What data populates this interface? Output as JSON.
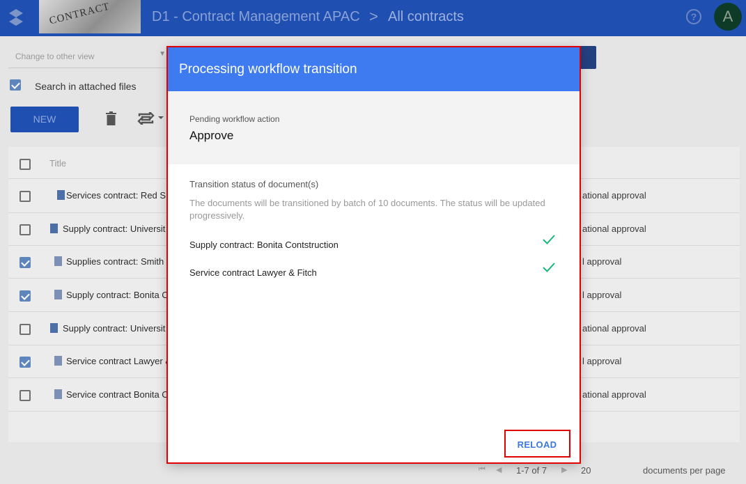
{
  "header": {
    "thumbnail_text": "CONTRACT",
    "breadcrumb_domain": "D1 - Contract Management APAC",
    "breadcrumb_separator": ">",
    "breadcrumb_page": "All contracts",
    "help_glyph": "?",
    "avatar_initial": "A",
    "color": "#1f4fb0"
  },
  "toolbar": {
    "view_placeholder": "Change to other view",
    "search_attached_label": "Search in attached files",
    "search_attached_checked": true,
    "new_label": "NEW",
    "icons": [
      "trash-icon",
      "transition-icon"
    ]
  },
  "table": {
    "column_title": "Title",
    "rows": [
      {
        "title": "Services contract: Red S",
        "status": "ational approval",
        "checked": false
      },
      {
        "title": "Supply contract: Universit",
        "status": "ational approval",
        "checked": false
      },
      {
        "title": "Supplies contract: Smith",
        "status": "l approval",
        "checked": true
      },
      {
        "title": "Supply contract: Bonita C",
        "status": "l approval",
        "checked": true
      },
      {
        "title": "Supply contract: Universit",
        "status": "ational approval",
        "checked": false
      },
      {
        "title": "Service contract Lawyer &",
        "status": "l approval",
        "checked": true
      },
      {
        "title": "Service contract Bonita C",
        "status": "ational approval",
        "checked": false
      }
    ]
  },
  "pagination": {
    "range": "1-7 of 7",
    "page_size": "20",
    "page_size_label": "documents per page"
  },
  "dialog": {
    "title": "Processing workflow transition",
    "pending_label": "Pending workflow action",
    "pending_value": "Approve",
    "status_title": "Transition status of document(s)",
    "status_desc": "The documents will be transitioned by batch of 10 documents. The status will be updated progressively.",
    "documents": [
      {
        "name": "Supply contract: Bonita Contstruction",
        "done": true
      },
      {
        "name": "Service contract Lawyer & Fitch",
        "done": true
      }
    ],
    "reload_label": "RELOAD",
    "header_color": "#3e7af0",
    "success_color": "#1ab67a",
    "highlight_color": "#e00000"
  }
}
